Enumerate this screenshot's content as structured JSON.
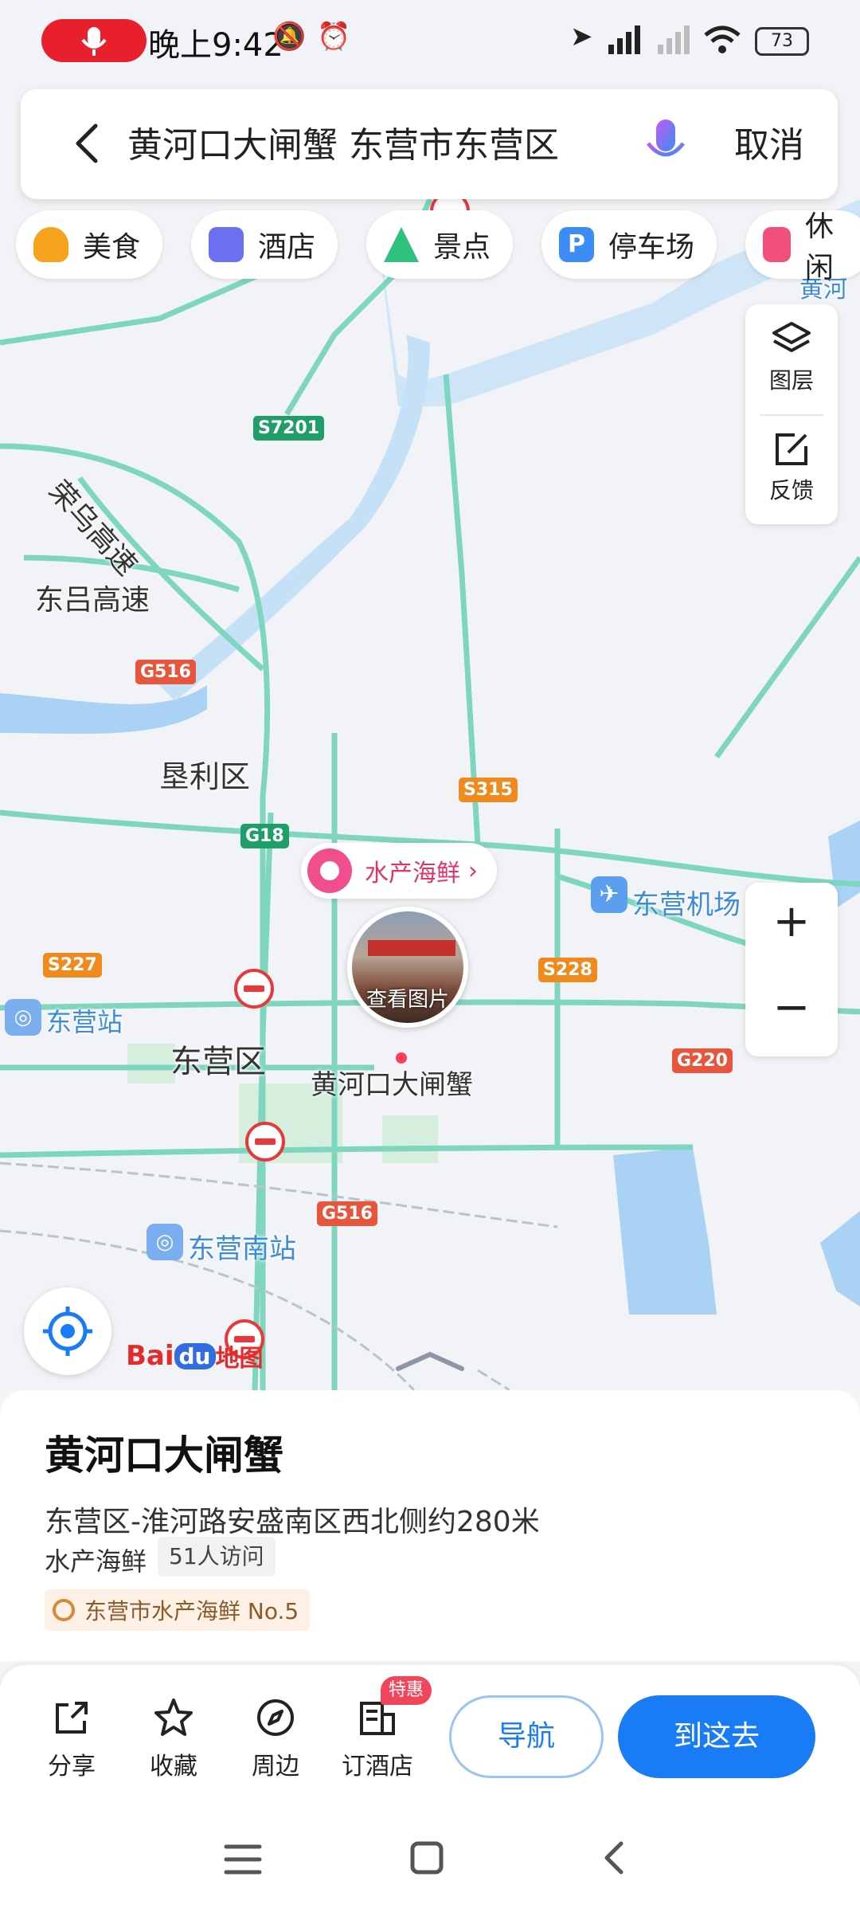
{
  "status": {
    "time": "晚上9:42",
    "battery": "73"
  },
  "search": {
    "query": "黄河口大闸蟹 东营市东营区",
    "cancel": "取消"
  },
  "categories": [
    {
      "label": "美食",
      "color": "#f7a21c"
    },
    {
      "label": "酒店",
      "color": "#6b6ff2"
    },
    {
      "label": "景点",
      "color": "#2ec27e"
    },
    {
      "label": "停车场",
      "color": "#3c8cf6"
    },
    {
      "label": "休闲",
      "color": "#f0507a"
    }
  ],
  "map": {
    "layers": "图层",
    "feedback": "反馈",
    "zoom_in": "+",
    "zoom_out": "−",
    "road_labels": {
      "rongwu": "荣乌高速",
      "donglv": "东吕高速",
      "kenli": "垦利区",
      "dongying_district": "东营区",
      "airport": "东营机场",
      "station": "东营站",
      "south_station": "东营南站",
      "huanghe_corner": "黄河"
    },
    "shields": {
      "s7201": "S7201",
      "g516a": "G516",
      "s315": "S315",
      "g18": "G18",
      "s227": "S227",
      "s228": "S228",
      "g220": "G220",
      "g516b": "G516"
    },
    "poi_category": "水产海鲜",
    "poi_photo": "查看图片",
    "poi_name": "黄河口大闸蟹",
    "logo_bai": "Bai",
    "logo_du": "du",
    "logo_map": "地图"
  },
  "card": {
    "title": "黄河口大闸蟹",
    "address": "东营区-淮河路安盛南区西北侧约280米",
    "category": "水产海鲜",
    "visits": "51人访问",
    "rank": "东营市水产海鲜 No.5"
  },
  "actions": {
    "share": "分享",
    "favorite": "收藏",
    "nearby": "周边",
    "hotel": "订酒店",
    "hotel_badge": "特惠",
    "navigate": "导航",
    "go": "到这去"
  },
  "colors": {
    "accent": "#1a7cf5",
    "road": "#7fd6bf",
    "river": "#a9d2f5"
  }
}
